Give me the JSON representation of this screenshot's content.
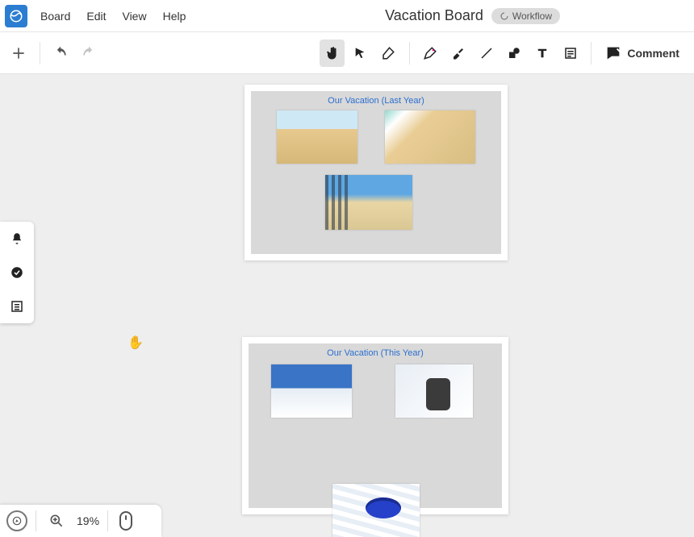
{
  "menu": {
    "items": [
      "Board",
      "Edit",
      "View",
      "Help"
    ],
    "board_title": "Vacation Board",
    "workflow_label": "Workflow"
  },
  "toolbar": {
    "comment_label": "Comment"
  },
  "frames": {
    "last_year": {
      "title": "Our Vacation (Last Year)"
    },
    "this_year": {
      "title": "Our Vacation (This Year)"
    }
  },
  "status": {
    "zoom_text": "19%"
  }
}
